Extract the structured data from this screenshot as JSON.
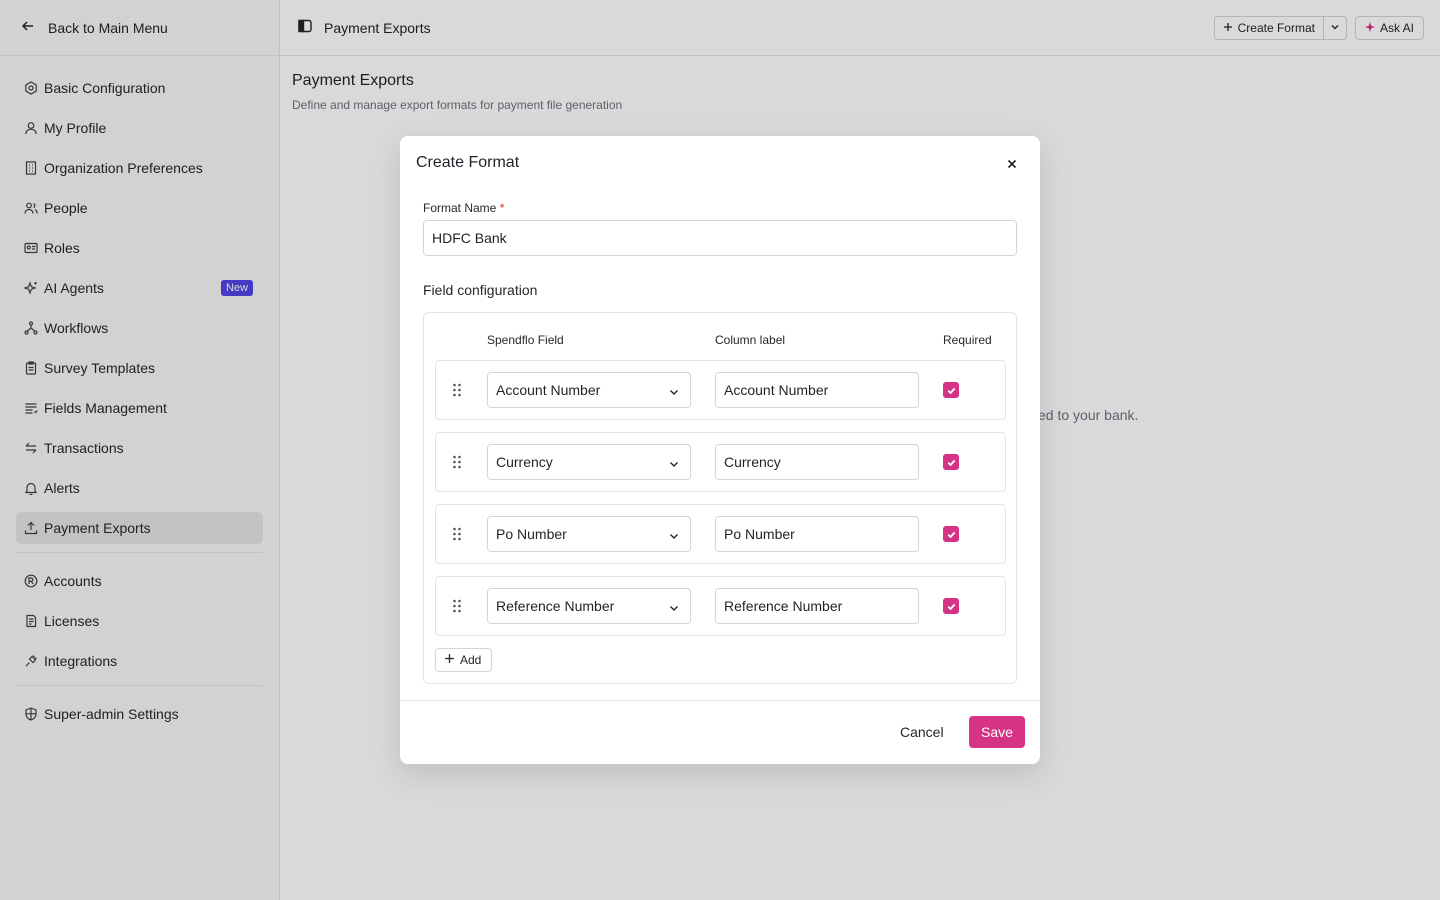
{
  "sidebar": {
    "back_label": "Back to Main Menu",
    "groups": [
      [
        {
          "label": "Basic Configuration",
          "icon": "settings-icon"
        },
        {
          "label": "My Profile",
          "icon": "user-icon"
        },
        {
          "label": "Organization Preferences",
          "icon": "building-icon"
        },
        {
          "label": "People",
          "icon": "users-icon"
        },
        {
          "label": "Roles",
          "icon": "roles-icon"
        },
        {
          "label": "AI Agents",
          "icon": "sparkle-icon",
          "badge": "New"
        },
        {
          "label": "Workflows",
          "icon": "workflow-icon"
        },
        {
          "label": "Survey Templates",
          "icon": "clipboard-icon"
        },
        {
          "label": "Fields Management",
          "icon": "list-icon"
        },
        {
          "label": "Transactions",
          "icon": "transactions-icon"
        },
        {
          "label": "Alerts",
          "icon": "bell-icon"
        },
        {
          "label": "Payment Exports",
          "icon": "upload-icon",
          "active": true
        }
      ],
      [
        {
          "label": "Accounts",
          "icon": "account-icon"
        },
        {
          "label": "Licenses",
          "icon": "license-icon"
        },
        {
          "label": "Integrations",
          "icon": "plug-icon"
        }
      ],
      [
        {
          "label": "Super-admin Settings",
          "icon": "shield-icon"
        }
      ]
    ]
  },
  "header": {
    "title": "Payment Exports",
    "create_label": "Create Format",
    "ask_ai_label": "Ask AI"
  },
  "page": {
    "title": "Payment Exports",
    "subtitle": "Define and manage export formats for payment file generation",
    "background_text": "ed to your bank."
  },
  "modal": {
    "title": "Create Format",
    "format_name_label": "Format Name",
    "required_mark": "*",
    "format_name_value": "HDFC Bank",
    "section_title": "Field configuration",
    "columns": {
      "field": "Spendflo Field",
      "label": "Column label",
      "required": "Required"
    },
    "rows": [
      {
        "field": "Account Number",
        "label": "Account Number",
        "required": true
      },
      {
        "field": "Currency",
        "label": "Currency",
        "required": true
      },
      {
        "field": "Po Number",
        "label": "Po Number",
        "required": true
      },
      {
        "field": "Reference Number",
        "label": "Reference Number",
        "required": true
      }
    ],
    "add_label": "Add",
    "cancel_label": "Cancel",
    "save_label": "Save"
  },
  "colors": {
    "accent": "#d63384",
    "badge": "#4f46e5"
  }
}
